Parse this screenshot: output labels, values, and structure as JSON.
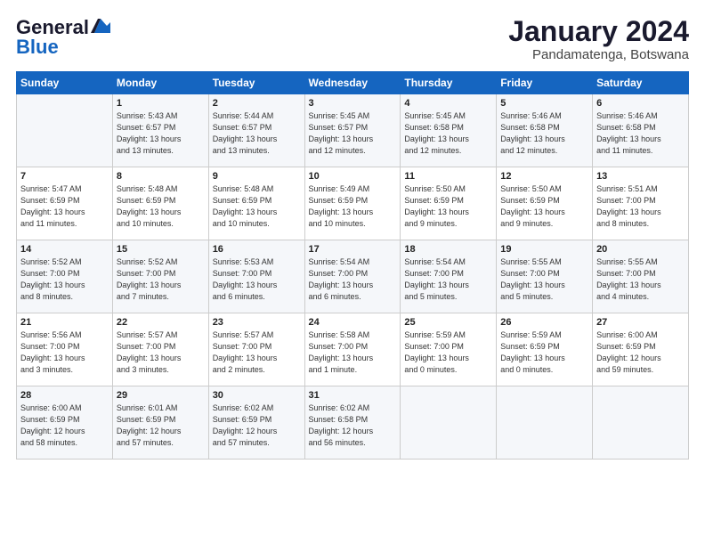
{
  "header": {
    "logo_general": "General",
    "logo_blue": "Blue",
    "month_title": "January 2024",
    "subtitle": "Pandamatenga, Botswana"
  },
  "weekdays": [
    "Sunday",
    "Monday",
    "Tuesday",
    "Wednesday",
    "Thursday",
    "Friday",
    "Saturday"
  ],
  "weeks": [
    [
      {
        "day": "",
        "info": ""
      },
      {
        "day": "1",
        "info": "Sunrise: 5:43 AM\nSunset: 6:57 PM\nDaylight: 13 hours\nand 13 minutes."
      },
      {
        "day": "2",
        "info": "Sunrise: 5:44 AM\nSunset: 6:57 PM\nDaylight: 13 hours\nand 13 minutes."
      },
      {
        "day": "3",
        "info": "Sunrise: 5:45 AM\nSunset: 6:57 PM\nDaylight: 13 hours\nand 12 minutes."
      },
      {
        "day": "4",
        "info": "Sunrise: 5:45 AM\nSunset: 6:58 PM\nDaylight: 13 hours\nand 12 minutes."
      },
      {
        "day": "5",
        "info": "Sunrise: 5:46 AM\nSunset: 6:58 PM\nDaylight: 13 hours\nand 12 minutes."
      },
      {
        "day": "6",
        "info": "Sunrise: 5:46 AM\nSunset: 6:58 PM\nDaylight: 13 hours\nand 11 minutes."
      }
    ],
    [
      {
        "day": "7",
        "info": "Sunrise: 5:47 AM\nSunset: 6:59 PM\nDaylight: 13 hours\nand 11 minutes."
      },
      {
        "day": "8",
        "info": "Sunrise: 5:48 AM\nSunset: 6:59 PM\nDaylight: 13 hours\nand 10 minutes."
      },
      {
        "day": "9",
        "info": "Sunrise: 5:48 AM\nSunset: 6:59 PM\nDaylight: 13 hours\nand 10 minutes."
      },
      {
        "day": "10",
        "info": "Sunrise: 5:49 AM\nSunset: 6:59 PM\nDaylight: 13 hours\nand 10 minutes."
      },
      {
        "day": "11",
        "info": "Sunrise: 5:50 AM\nSunset: 6:59 PM\nDaylight: 13 hours\nand 9 minutes."
      },
      {
        "day": "12",
        "info": "Sunrise: 5:50 AM\nSunset: 6:59 PM\nDaylight: 13 hours\nand 9 minutes."
      },
      {
        "day": "13",
        "info": "Sunrise: 5:51 AM\nSunset: 7:00 PM\nDaylight: 13 hours\nand 8 minutes."
      }
    ],
    [
      {
        "day": "14",
        "info": "Sunrise: 5:52 AM\nSunset: 7:00 PM\nDaylight: 13 hours\nand 8 minutes."
      },
      {
        "day": "15",
        "info": "Sunrise: 5:52 AM\nSunset: 7:00 PM\nDaylight: 13 hours\nand 7 minutes."
      },
      {
        "day": "16",
        "info": "Sunrise: 5:53 AM\nSunset: 7:00 PM\nDaylight: 13 hours\nand 6 minutes."
      },
      {
        "day": "17",
        "info": "Sunrise: 5:54 AM\nSunset: 7:00 PM\nDaylight: 13 hours\nand 6 minutes."
      },
      {
        "day": "18",
        "info": "Sunrise: 5:54 AM\nSunset: 7:00 PM\nDaylight: 13 hours\nand 5 minutes."
      },
      {
        "day": "19",
        "info": "Sunrise: 5:55 AM\nSunset: 7:00 PM\nDaylight: 13 hours\nand 5 minutes."
      },
      {
        "day": "20",
        "info": "Sunrise: 5:55 AM\nSunset: 7:00 PM\nDaylight: 13 hours\nand 4 minutes."
      }
    ],
    [
      {
        "day": "21",
        "info": "Sunrise: 5:56 AM\nSunset: 7:00 PM\nDaylight: 13 hours\nand 3 minutes."
      },
      {
        "day": "22",
        "info": "Sunrise: 5:57 AM\nSunset: 7:00 PM\nDaylight: 13 hours\nand 3 minutes."
      },
      {
        "day": "23",
        "info": "Sunrise: 5:57 AM\nSunset: 7:00 PM\nDaylight: 13 hours\nand 2 minutes."
      },
      {
        "day": "24",
        "info": "Sunrise: 5:58 AM\nSunset: 7:00 PM\nDaylight: 13 hours\nand 1 minute."
      },
      {
        "day": "25",
        "info": "Sunrise: 5:59 AM\nSunset: 7:00 PM\nDaylight: 13 hours\nand 0 minutes."
      },
      {
        "day": "26",
        "info": "Sunrise: 5:59 AM\nSunset: 6:59 PM\nDaylight: 13 hours\nand 0 minutes."
      },
      {
        "day": "27",
        "info": "Sunrise: 6:00 AM\nSunset: 6:59 PM\nDaylight: 12 hours\nand 59 minutes."
      }
    ],
    [
      {
        "day": "28",
        "info": "Sunrise: 6:00 AM\nSunset: 6:59 PM\nDaylight: 12 hours\nand 58 minutes."
      },
      {
        "day": "29",
        "info": "Sunrise: 6:01 AM\nSunset: 6:59 PM\nDaylight: 12 hours\nand 57 minutes."
      },
      {
        "day": "30",
        "info": "Sunrise: 6:02 AM\nSunset: 6:59 PM\nDaylight: 12 hours\nand 57 minutes."
      },
      {
        "day": "31",
        "info": "Sunrise: 6:02 AM\nSunset: 6:58 PM\nDaylight: 12 hours\nand 56 minutes."
      },
      {
        "day": "",
        "info": ""
      },
      {
        "day": "",
        "info": ""
      },
      {
        "day": "",
        "info": ""
      }
    ]
  ]
}
